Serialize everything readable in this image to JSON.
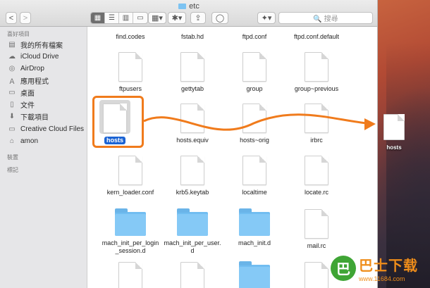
{
  "window": {
    "title": "etc"
  },
  "toolbar": {
    "back": "<",
    "forward": ">",
    "view_icons": [
      "grid",
      "list",
      "columns",
      "cover"
    ],
    "arrange": "▦▾",
    "action": "✱▾",
    "share": "⇪",
    "tag": "◯",
    "dropbox": "✦▾",
    "search_placeholder": "🔍 搜尋"
  },
  "sidebar": {
    "favorites_header": "喜好項目",
    "items": [
      {
        "label": "我的所有檔案",
        "icon": "all-files-icon",
        "glyph": "▤"
      },
      {
        "label": "iCloud Drive",
        "icon": "cloud-icon",
        "glyph": "☁"
      },
      {
        "label": "AirDrop",
        "icon": "airdrop-icon",
        "glyph": "◎"
      },
      {
        "label": "應用程式",
        "icon": "applications-icon",
        "glyph": "Ａ"
      },
      {
        "label": "桌面",
        "icon": "desktop-icon",
        "glyph": "▭"
      },
      {
        "label": "文件",
        "icon": "documents-icon",
        "glyph": "▯"
      },
      {
        "label": "下載項目",
        "icon": "downloads-icon",
        "glyph": "⬇"
      },
      {
        "label": "Creative Cloud Files",
        "icon": "folder-icon",
        "glyph": "▭"
      },
      {
        "label": "amon",
        "icon": "home-icon",
        "glyph": "⌂"
      }
    ],
    "devices_header": "裝置",
    "tags_header": "標記"
  },
  "files": [
    {
      "name": "find.codes",
      "kind": "doc"
    },
    {
      "name": "fstab.hd",
      "kind": "doc"
    },
    {
      "name": "ftpd.conf",
      "kind": "doc"
    },
    {
      "name": "ftpd.conf.default",
      "kind": "doc"
    },
    {
      "name": "ftpusers",
      "kind": "doc"
    },
    {
      "name": "gettytab",
      "kind": "doc"
    },
    {
      "name": "group",
      "kind": "doc"
    },
    {
      "name": "group~previous",
      "kind": "doc"
    },
    {
      "name": "hosts",
      "kind": "doc",
      "selected": true
    },
    {
      "name": "hosts.equiv",
      "kind": "doc"
    },
    {
      "name": "hosts~orig",
      "kind": "doc"
    },
    {
      "name": "irbrc",
      "kind": "doc"
    },
    {
      "name": "kern_loader.conf",
      "kind": "doc"
    },
    {
      "name": "krb5.keytab",
      "kind": "doc"
    },
    {
      "name": "localtime",
      "kind": "doc"
    },
    {
      "name": "locate.rc",
      "kind": "doc"
    },
    {
      "name": "mach_init_per_login_session.d",
      "kind": "folder",
      "lines": [
        "mach_init_per_login",
        "_session.d"
      ]
    },
    {
      "name": "mach_init_per_user.d",
      "kind": "folder",
      "lines": [
        "mach_init_per_user.",
        "d"
      ]
    },
    {
      "name": "mach_init.d",
      "kind": "folder"
    },
    {
      "name": "mail.rc",
      "kind": "doc"
    }
  ],
  "desktop": {
    "file_label": "hosts"
  },
  "watermark": {
    "title": "巴士下载",
    "url": "www.11684.com",
    "badge": "巴"
  },
  "annotation": {
    "arrow_color": "#f07b1c"
  }
}
